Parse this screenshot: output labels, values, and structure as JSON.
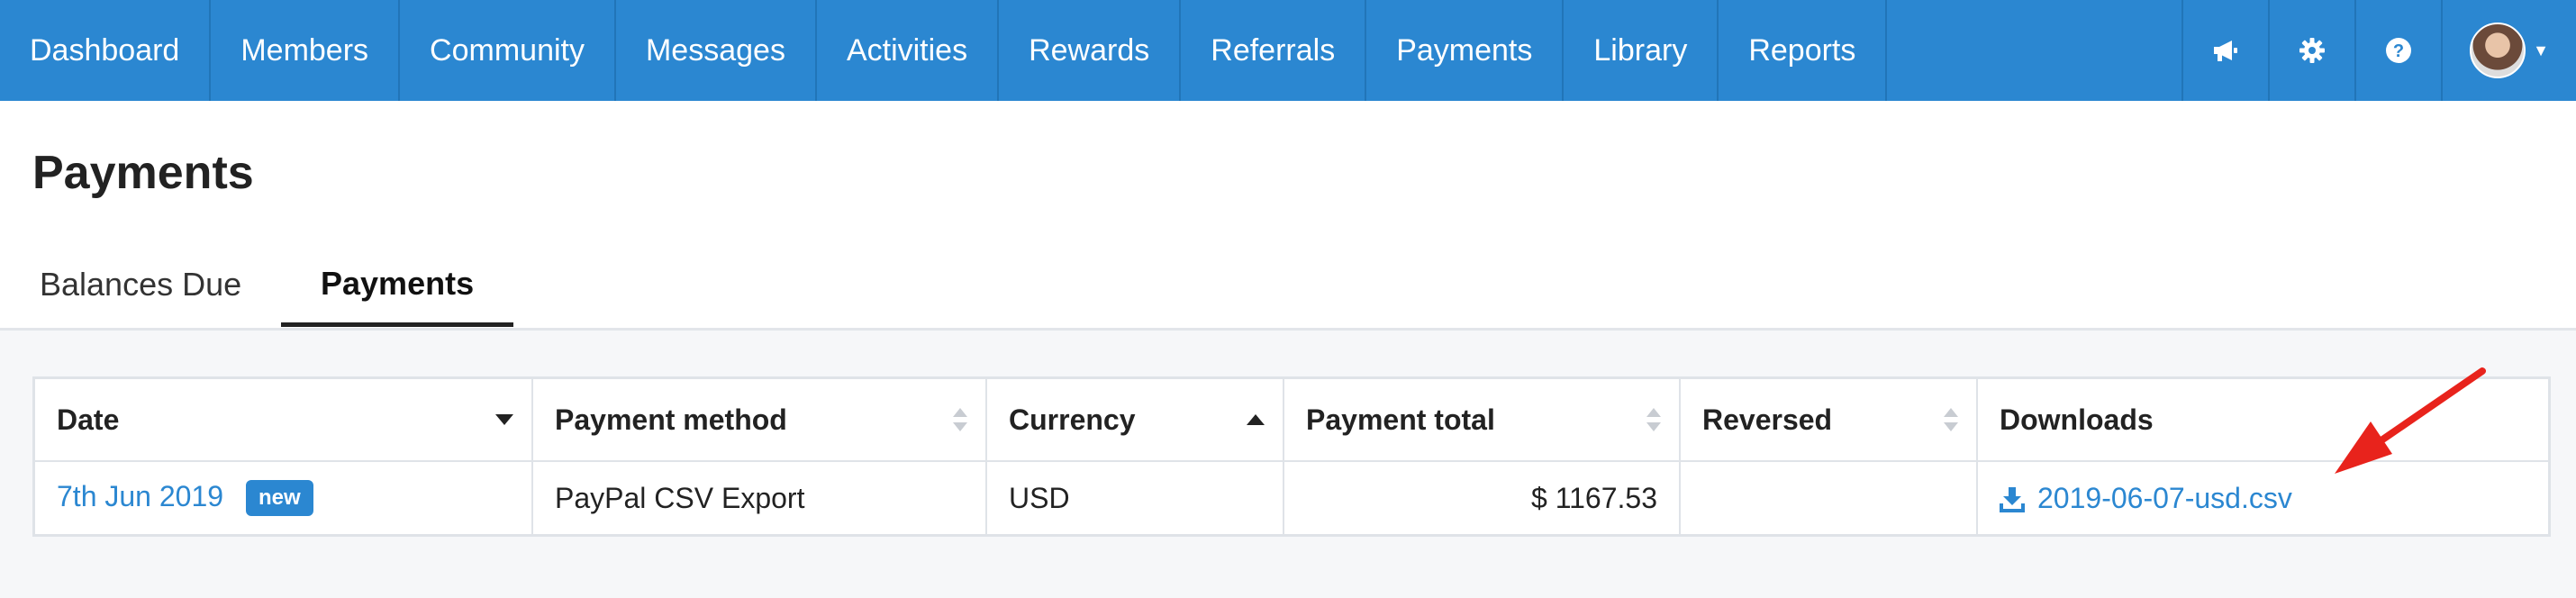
{
  "nav": {
    "items": [
      "Dashboard",
      "Members",
      "Community",
      "Messages",
      "Activities",
      "Rewards",
      "Referrals",
      "Payments",
      "Library",
      "Reports"
    ],
    "icons": [
      "megaphone-icon",
      "gear-icon",
      "help-icon"
    ]
  },
  "page": {
    "title": "Payments",
    "tabs": [
      {
        "label": "Balances Due",
        "active": false
      },
      {
        "label": "Payments",
        "active": true
      }
    ]
  },
  "table": {
    "columns": [
      {
        "label": "Date",
        "sort": "desc"
      },
      {
        "label": "Payment method",
        "sort": "none"
      },
      {
        "label": "Currency",
        "sort": "asc"
      },
      {
        "label": "Payment total",
        "sort": "none"
      },
      {
        "label": "Reversed",
        "sort": "none"
      },
      {
        "label": "Downloads",
        "sort": "none"
      }
    ],
    "rows": [
      {
        "date": "7th Jun 2019",
        "badge": "new",
        "method": "PayPal CSV Export",
        "currency": "USD",
        "total": "$ 1167.53",
        "reversed": "",
        "download": "2019-06-07-usd.csv"
      }
    ]
  },
  "colors": {
    "nav_bg": "#2b87d1",
    "link": "#2b87d1",
    "annotation_arrow": "#e8231c"
  }
}
